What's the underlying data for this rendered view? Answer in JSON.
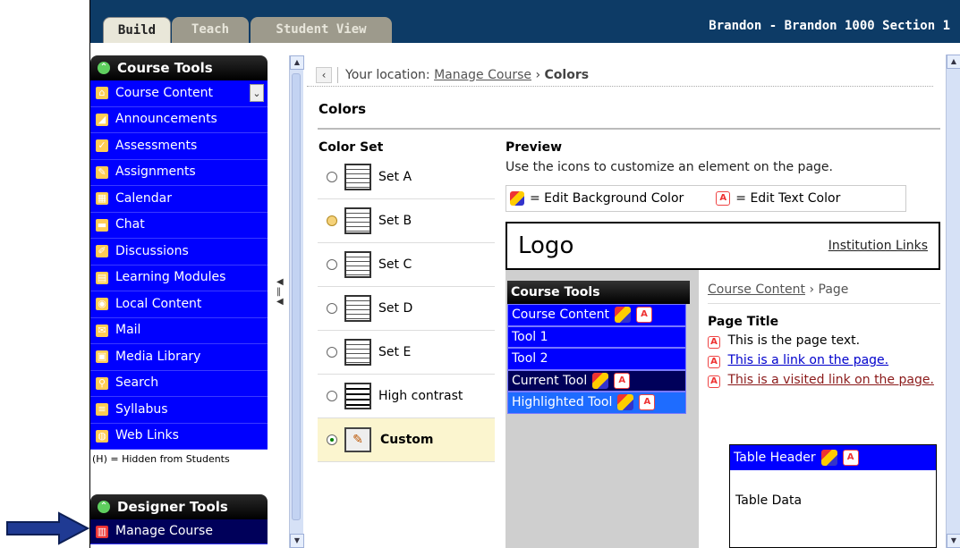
{
  "tabs": [
    {
      "label": "Build"
    },
    {
      "label": "Teach"
    },
    {
      "label": "Student View"
    }
  ],
  "course_title": "Brandon - Brandon 1000 Section 1",
  "sidebar": {
    "course_tools_header": "Course Tools",
    "items": [
      {
        "label": "Course Content",
        "icon": "house-icon"
      },
      {
        "label": "Announcements",
        "icon": "megaphone-icon"
      },
      {
        "label": "Assessments",
        "icon": "assessment-icon"
      },
      {
        "label": "Assignments",
        "icon": "assignment-icon"
      },
      {
        "label": "Calendar",
        "icon": "calendar-icon"
      },
      {
        "label": "Chat",
        "icon": "chat-icon"
      },
      {
        "label": "Discussions",
        "icon": "pen-icon"
      },
      {
        "label": "Learning Modules",
        "icon": "modules-icon"
      },
      {
        "label": "Local Content",
        "icon": "disc-icon"
      },
      {
        "label": "Mail",
        "icon": "mail-icon"
      },
      {
        "label": "Media Library",
        "icon": "media-icon"
      },
      {
        "label": "Search",
        "icon": "search-icon"
      },
      {
        "label": "Syllabus",
        "icon": "syllabus-icon"
      },
      {
        "label": "Web Links",
        "icon": "globe-icon"
      }
    ],
    "hidden_note": "(H) = Hidden from Students",
    "designer_tools_header": "Designer Tools",
    "manage_course": "Manage Course"
  },
  "breadcrumb": {
    "prefix": "Your location:",
    "link": "Manage Course",
    "separator": "›",
    "current": "Colors"
  },
  "page_title": "Colors",
  "color_set": {
    "header": "Color Set",
    "options": [
      {
        "label": "Set A",
        "state": "unselected"
      },
      {
        "label": "Set B",
        "state": "highlighted"
      },
      {
        "label": "Set C",
        "state": "unselected"
      },
      {
        "label": "Set D",
        "state": "unselected"
      },
      {
        "label": "Set E",
        "state": "unselected"
      },
      {
        "label": "High contrast",
        "state": "unselected"
      },
      {
        "label": "Custom",
        "state": "selected"
      }
    ]
  },
  "preview": {
    "header": "Preview",
    "description": "Use the icons to customize an element on the page.",
    "legend_bg": "= Edit Background Color",
    "legend_text": "= Edit Text Color",
    "logo": "Logo",
    "institution_links": "Institution Links",
    "nav_header": "Course Tools",
    "nav_items": [
      {
        "label": "Course Content",
        "style": "normal"
      },
      {
        "label": "Tool 1",
        "style": "normal"
      },
      {
        "label": "Tool 2",
        "style": "normal"
      },
      {
        "label": "Current Tool",
        "style": "current"
      },
      {
        "label": "Highlighted Tool",
        "style": "highlight"
      }
    ],
    "crumb_link": "Course Content",
    "crumb_sep": "›",
    "crumb_current": "Page",
    "page_title": "Page Title",
    "page_text": "This is the page text.",
    "link_text": "This is a link on the page.",
    "visited_text": "This is a visited link on the page.",
    "table_header": "Table Header",
    "table_data": "Table Data"
  },
  "colors": {
    "nav_blue": "#0000ff",
    "top_bar": "#0d3b66",
    "current_tool": "#00005a",
    "custom_row": "#fbf5cf"
  }
}
